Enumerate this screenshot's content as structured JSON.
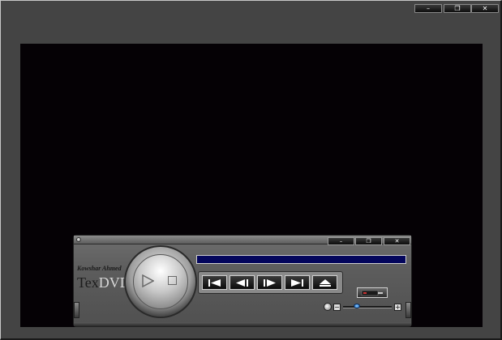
{
  "window": {
    "buttons": {
      "minimize": "–",
      "restore": "❐",
      "close": "✕"
    }
  },
  "player": {
    "author": "Kowshar Ahmed",
    "brand_part1": "Tex",
    "brand_part2": "DVD",
    "titlebar_buttons": {
      "minimize": "–",
      "restore": "❐",
      "close": "✕"
    },
    "volume_minus": "−",
    "volume_plus": "+",
    "volume_level": 0.25,
    "progress": 0
  },
  "colors": {
    "video_bg": "#050105",
    "progress_fill": "#04065c",
    "volume_thumb": "#2a8cf0"
  },
  "icons": [
    "play-icon",
    "stop-icon",
    "skip-previous-icon",
    "step-back-icon",
    "step-forward-icon",
    "skip-next-icon",
    "eject-icon",
    "capture-icon"
  ]
}
